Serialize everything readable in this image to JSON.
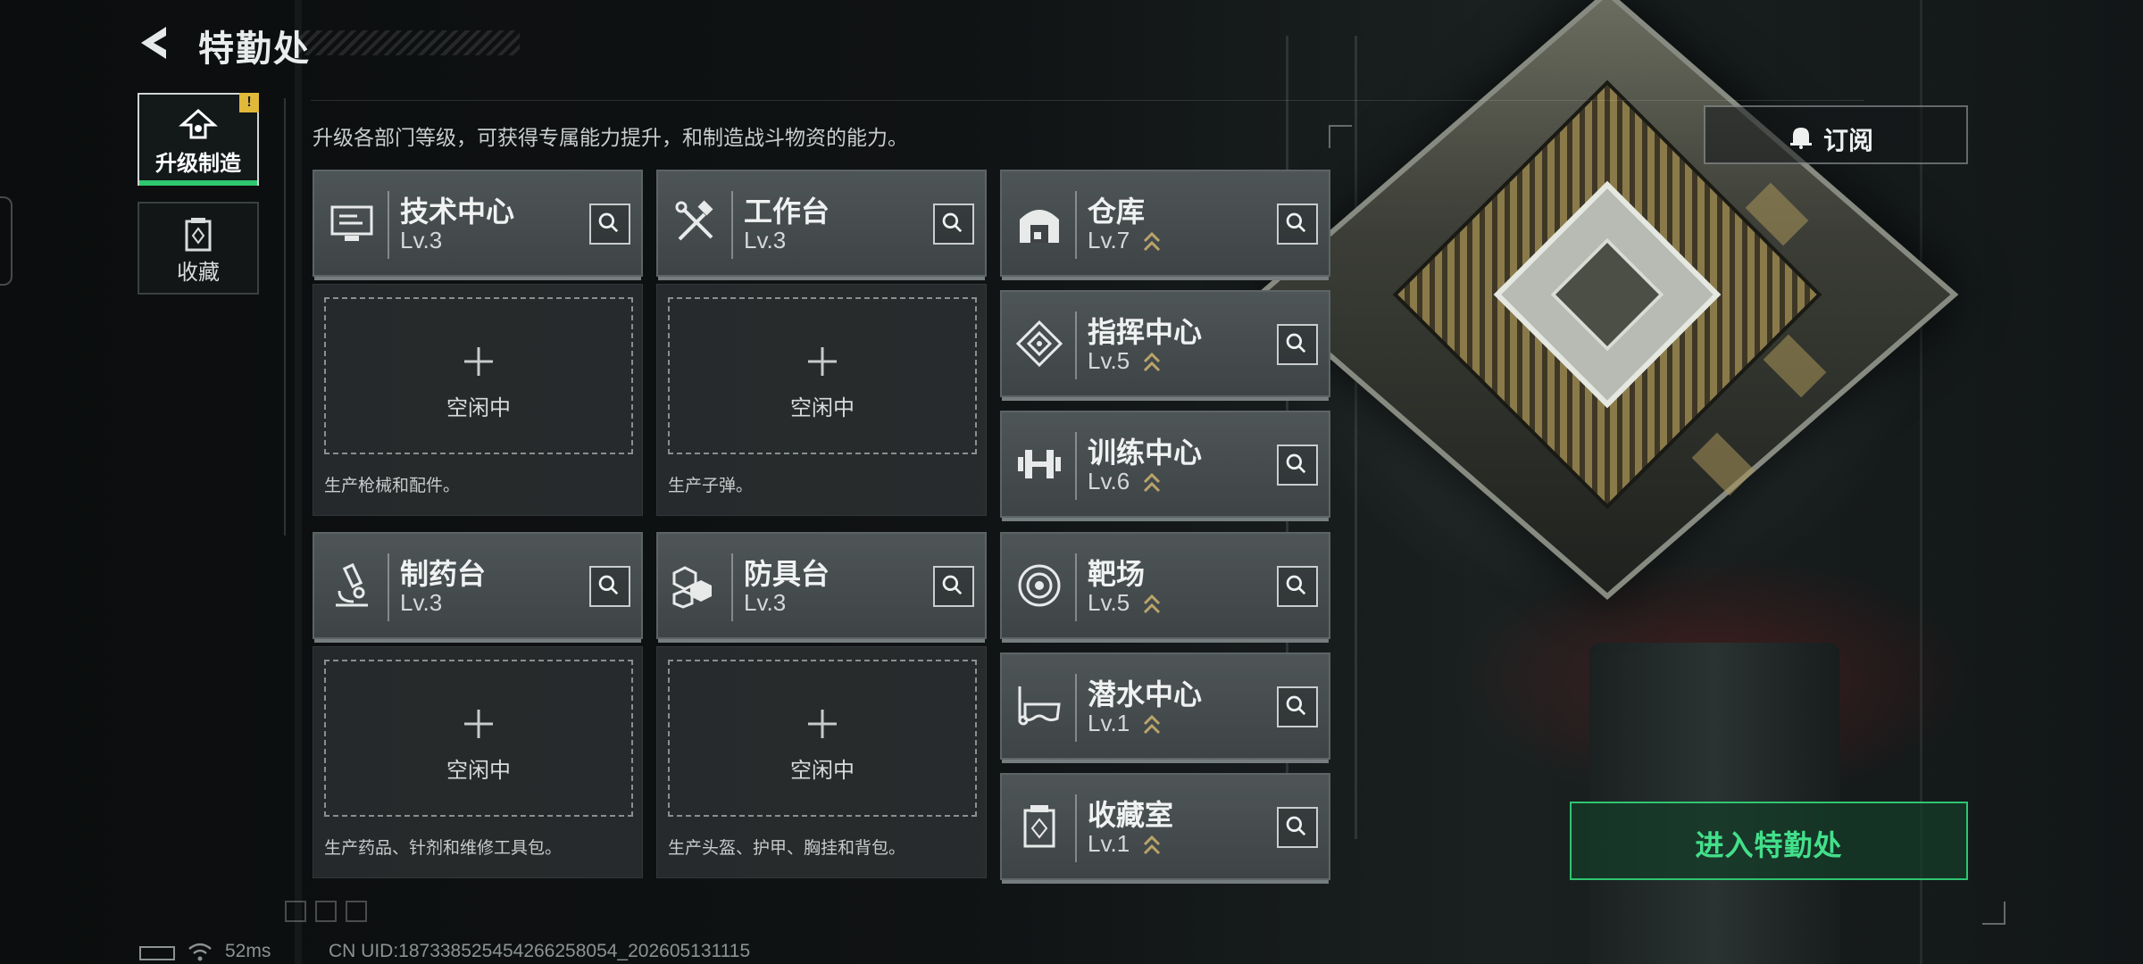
{
  "header": {
    "title": "特勤处"
  },
  "side_tabs": [
    {
      "label": "升级制造",
      "icon": "upgrade-icon",
      "active": true,
      "badge": "!"
    },
    {
      "label": "收藏",
      "icon": "collection-icon",
      "active": false
    }
  ],
  "subtitle": "升级各部门等级，可获得专属能力提升，和制造战斗物资的能力。",
  "facilities": [
    {
      "name": "技术中心",
      "level": "Lv.3",
      "icon": "monitor-icon",
      "upgradable": false
    },
    {
      "name": "工作台",
      "level": "Lv.3",
      "icon": "tools-icon",
      "upgradable": false
    },
    {
      "name": "仓库",
      "level": "Lv.7",
      "icon": "warehouse-icon",
      "upgradable": true
    },
    {
      "name": "指挥中心",
      "level": "Lv.5",
      "icon": "command-icon",
      "upgradable": true
    },
    {
      "name": "训练中心",
      "level": "Lv.6",
      "icon": "dumbbell-icon",
      "upgradable": true
    },
    {
      "name": "制药台",
      "level": "Lv.3",
      "icon": "microscope-icon",
      "upgradable": false
    },
    {
      "name": "防具台",
      "level": "Lv.3",
      "icon": "armor-blocks-icon",
      "upgradable": false
    },
    {
      "name": "靶场",
      "level": "Lv.5",
      "icon": "target-icon",
      "upgradable": true
    },
    {
      "name": "潜水中心",
      "level": "Lv.1",
      "icon": "diving-mask-icon",
      "upgradable": true
    },
    {
      "name": "收藏室",
      "level": "Lv.1",
      "icon": "collection-room-icon",
      "upgradable": true
    }
  ],
  "production": [
    {
      "status": "空闲中",
      "desc": "生产枪械和配件。"
    },
    {
      "status": "空闲中",
      "desc": "生产子弹。"
    },
    {
      "status": "空闲中",
      "desc": "生产药品、针剂和维修工具包。"
    },
    {
      "status": "空闲中",
      "desc": "生产头盔、护甲、胸挂和背包。"
    }
  ],
  "buttons": {
    "subscribe": "订阅",
    "enter": "进入特勤处"
  },
  "status_bar": {
    "ping": "52ms",
    "uid": "CN UID:187338525454266258054_202605131115"
  },
  "colors": {
    "accent_green": "#2ec76e",
    "alert_yellow": "#e0b93a",
    "upgrade_chevron": "#b9a46a"
  }
}
